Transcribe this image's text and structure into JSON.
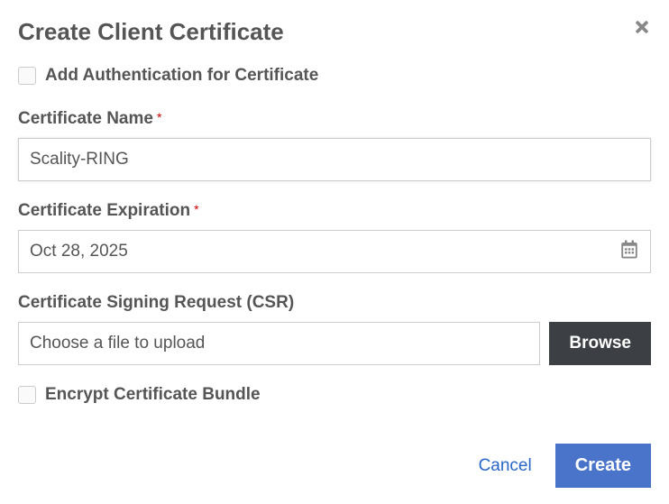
{
  "dialog": {
    "title": "Create Client Certificate"
  },
  "auth_checkbox": {
    "label": "Add Authentication for Certificate",
    "checked": false
  },
  "cert_name": {
    "label": "Certificate Name",
    "required_mark": "*",
    "value": "Scality-RING"
  },
  "cert_expiration": {
    "label": "Certificate Expiration",
    "required_mark": "*",
    "value": "Oct 28, 2025"
  },
  "csr": {
    "label": "Certificate Signing Request (CSR)",
    "placeholder": "Choose a file to upload",
    "browse_label": "Browse"
  },
  "encrypt_checkbox": {
    "label": "Encrypt Certificate Bundle",
    "checked": false
  },
  "footer": {
    "cancel_label": "Cancel",
    "create_label": "Create"
  }
}
